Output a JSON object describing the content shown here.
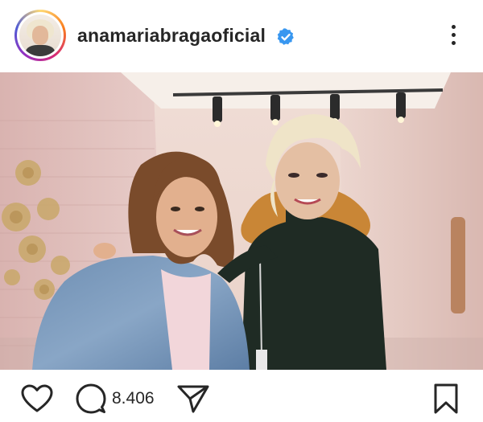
{
  "post": {
    "username": "anamariabragaoficial",
    "verified": true,
    "comment_count": "8.406"
  },
  "icons": {
    "verified": "verified-badge-icon",
    "more": "more-options-icon",
    "like": "heart-icon",
    "comment": "comment-icon",
    "share": "send-icon",
    "save": "bookmark-icon"
  },
  "colors": {
    "verified_blue": "#3897f0",
    "text": "#262626",
    "ring_gradient": [
      "#feda75",
      "#fa7e1e",
      "#d62976",
      "#962fbf",
      "#4f5bd5"
    ]
  }
}
